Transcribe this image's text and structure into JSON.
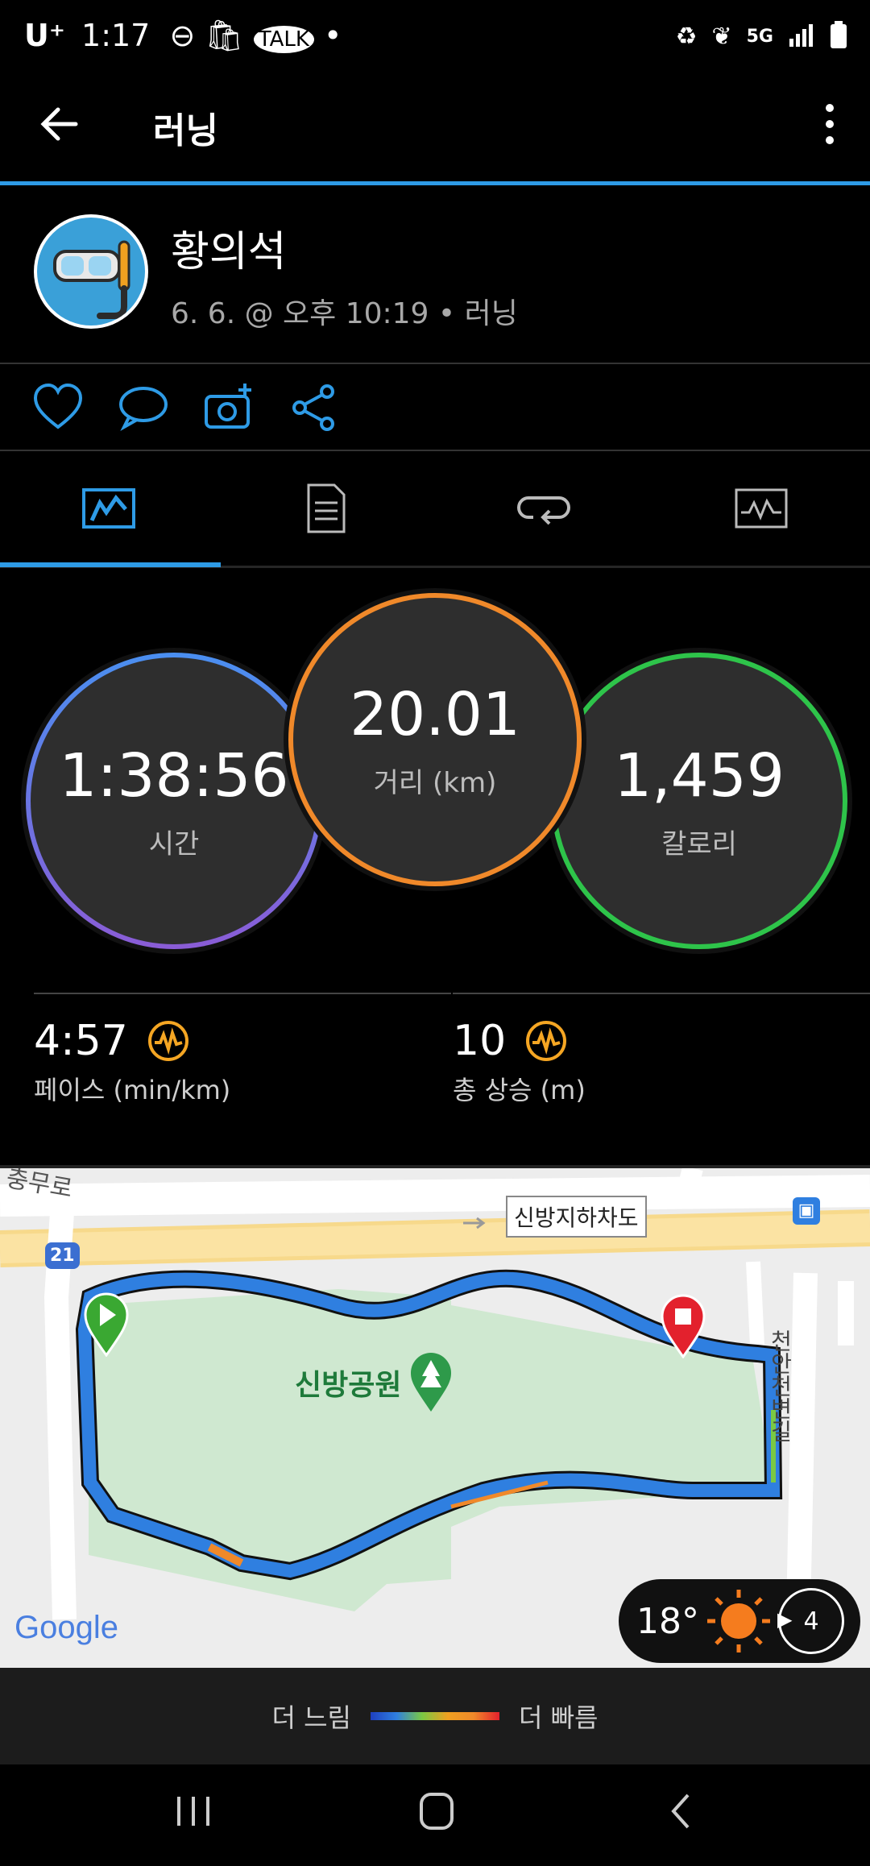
{
  "status_bar": {
    "carrier": "U⁺",
    "time": "1:17",
    "network": "5G"
  },
  "app_bar": {
    "title": "러닝"
  },
  "profile": {
    "name": "황의석",
    "meta": "6. 6. @ 오후 10:19 • 러닝"
  },
  "tabs": [
    {
      "name": "overview",
      "icon": "chart-card-icon",
      "active": true
    },
    {
      "name": "stats",
      "icon": "document-icon",
      "active": false
    },
    {
      "name": "laps",
      "icon": "loop-arrow-icon",
      "active": false
    },
    {
      "name": "charts",
      "icon": "graph-icon",
      "active": false
    }
  ],
  "stats": {
    "time": {
      "value": "1:38:56",
      "label": "시간"
    },
    "distance": {
      "value": "20.01",
      "label": "거리 (km)"
    },
    "calories": {
      "value": "1,459",
      "label": "칼로리"
    },
    "pace": {
      "value": "4:57",
      "label": "페이스 (min/km)"
    },
    "ascent": {
      "value": "10",
      "label": "총 상승 (m)"
    }
  },
  "map": {
    "road_label_top_left": "충무로",
    "underpass_label": "신방지하차도",
    "route_number": "21",
    "park_label": "신방공원",
    "stream_road_label": "천안천변길",
    "google_logo": "Google",
    "temperature": "18°",
    "wind_speed": "4"
  },
  "legend": {
    "slower": "더 느림",
    "faster": "더 빠름"
  },
  "colors": {
    "accent": "#2e9be6",
    "distance_ring": "#f0892a",
    "calories_ring": "#2ec44a",
    "pace_icon": "#f5a623"
  }
}
